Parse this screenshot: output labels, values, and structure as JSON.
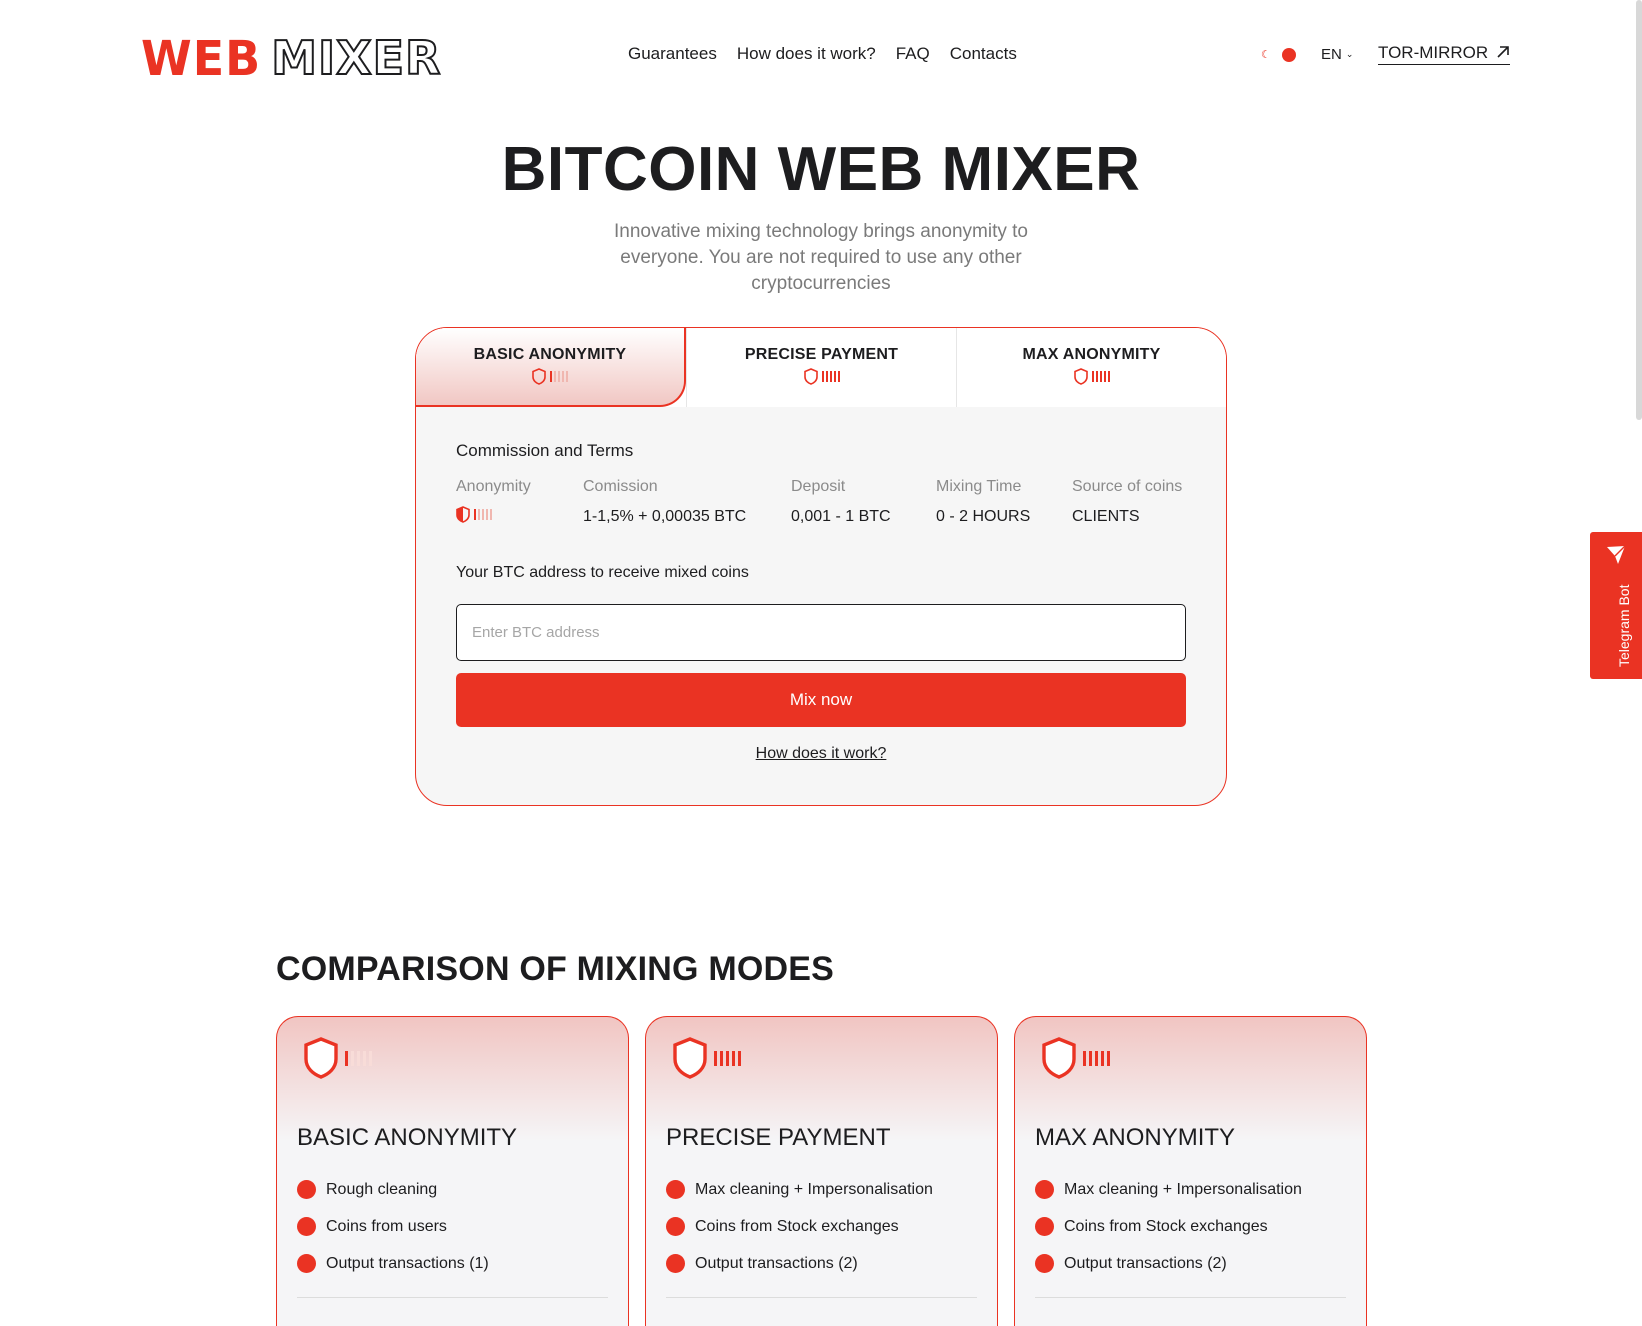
{
  "header": {
    "logo_left": "WEB",
    "logo_right": "MIXER",
    "nav": [
      "Guarantees",
      "How does it work?",
      "FAQ",
      "Contacts"
    ],
    "lang": "EN",
    "tor_mirror": "TOR-MIRROR"
  },
  "hero": {
    "title": "BITCOIN WEB MIXER",
    "subtitle": "Innovative mixing technology brings anonymity to everyone. You are not required to use any other cryptocurrencies"
  },
  "mixer": {
    "tabs": [
      {
        "label": "BASIC ANONYMITY",
        "level": 1
      },
      {
        "label": "PRECISE PAYMENT",
        "level": 5
      },
      {
        "label": "MAX ANONYMITY",
        "level": 5
      }
    ],
    "active_tab": 0,
    "commission_title": "Commission and Terms",
    "terms": {
      "anonymity_label": "Anonymity",
      "commission_label": "Comission",
      "commission_value": "1-1,5% + 0,00035 BTC",
      "deposit_label": "Deposit",
      "deposit_value": "0,001 - 1 BTC",
      "time_label": "Mixing Time",
      "time_value": "0 - 2 HOURS",
      "source_label": "Source of coins",
      "source_value": "CLIENTS"
    },
    "address_label": "Your BTC address to receive mixed coins",
    "address_placeholder": "Enter BTC address",
    "address_value": "",
    "mix_button": "Mix now",
    "how_link": "How does it work?"
  },
  "telegram": {
    "label": "Telegram Bot"
  },
  "comparison": {
    "title": "COMPARISON OF MIXING MODES",
    "cards": [
      {
        "title": "BASIC ANONYMITY",
        "level": 1,
        "features": [
          "Rough cleaning",
          "Coins from users",
          "Output transactions (1)"
        ]
      },
      {
        "title": "PRECISE PAYMENT",
        "level": 5,
        "features": [
          "Max cleaning + Impersonalisation",
          "Coins from Stock exchanges",
          "Output transactions (2)"
        ]
      },
      {
        "title": "MAX ANONYMITY",
        "level": 5,
        "features": [
          "Max cleaning + Impersonalisation",
          "Coins from Stock exchanges",
          "Output transactions (2)"
        ]
      }
    ]
  },
  "colors": {
    "accent": "#ea3323",
    "text": "#1d1d1f",
    "muted": "#8b8b8b"
  }
}
